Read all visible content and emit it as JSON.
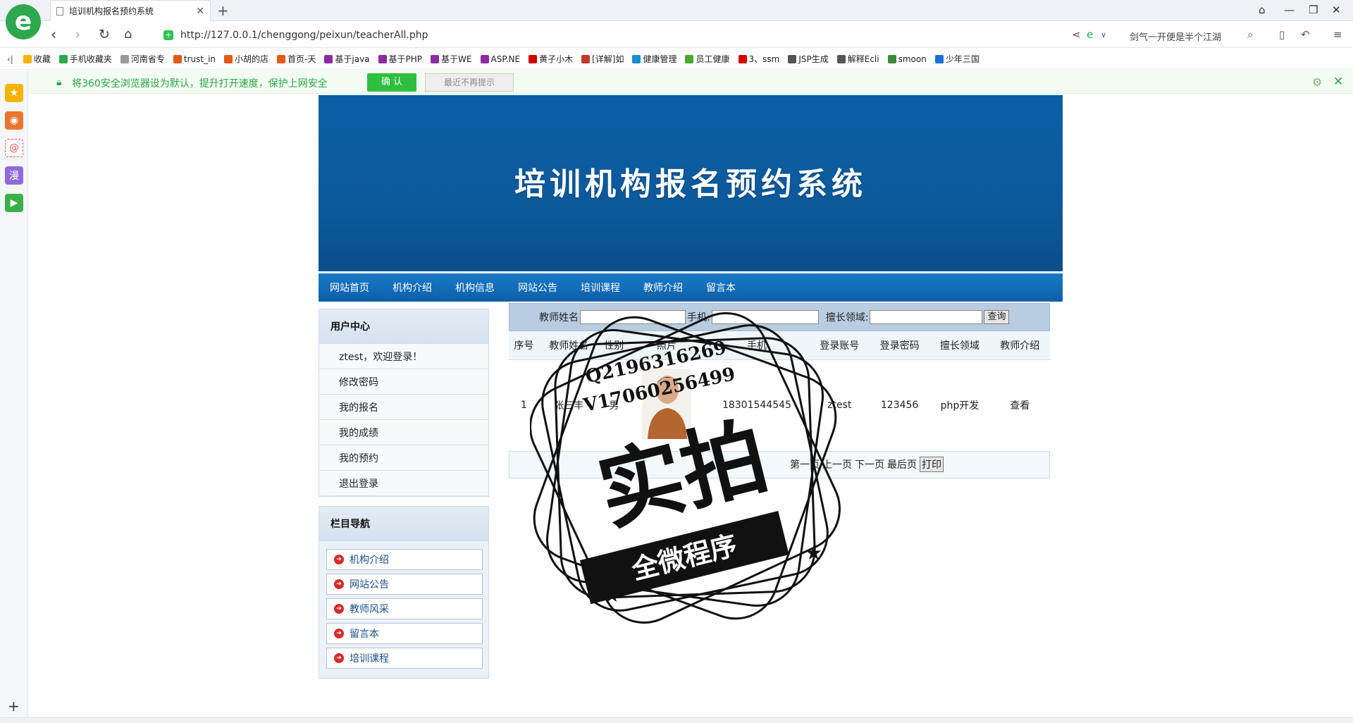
{
  "browser": {
    "tab_title": "培训机构报名预约系统",
    "url": "http://127.0.0.1/chenggong/peixun/teacherAll.php",
    "search_text": "剑气一开便是半个江湖"
  },
  "bookmarks": [
    {
      "label": "收藏",
      "color": "#f5b400"
    },
    {
      "label": "手机收藏夹",
      "color": "#2da84f"
    },
    {
      "label": "河南省专",
      "color": "#999999"
    },
    {
      "label": "trust_in",
      "color": "#e05a1a"
    },
    {
      "label": "小胡的店",
      "color": "#e05a1a"
    },
    {
      "label": "首页-天",
      "color": "#e05a1a"
    },
    {
      "label": "基于java",
      "color": "#8a2ca0"
    },
    {
      "label": "基于PHP",
      "color": "#8a2ca0"
    },
    {
      "label": "基于WE",
      "color": "#8a2ca0"
    },
    {
      "label": "ASP.NE",
      "color": "#8a2ca0"
    },
    {
      "label": "黄子小木",
      "color": "#d00000"
    },
    {
      "label": "[详解]如",
      "color": "#c0392b"
    },
    {
      "label": "健康管理",
      "color": "#1a8fd0"
    },
    {
      "label": "员工健康",
      "color": "#4aa832"
    },
    {
      "label": "3、ssm",
      "color": "#d00000"
    },
    {
      "label": "JSP生成",
      "color": "#555555"
    },
    {
      "label": "解释Ecli",
      "color": "#555555"
    },
    {
      "label": "smoon",
      "color": "#3b8b3b"
    },
    {
      "label": "少年三国",
      "color": "#1a6fd0"
    }
  ],
  "infobar": {
    "message": "将360安全浏览器设为默认，提升打开速度，保护上网安全",
    "confirm": "确 认",
    "dismiss": "最近不再提示"
  },
  "site": {
    "title": "培训机构报名预约系统",
    "nav": [
      "网站首页",
      "机构介绍",
      "机构信息",
      "网站公告",
      "培训课程",
      "教师介绍",
      "留言本"
    ]
  },
  "user_center": {
    "title": "用户中心",
    "items": [
      "ztest，欢迎登录！",
      "修改密码",
      "我的报名",
      "我的成绩",
      "我的预约",
      "退出登录"
    ]
  },
  "column_nav": {
    "title": "栏目导航",
    "items": [
      "机构介绍",
      "网站公告",
      "教师风采",
      "留言本",
      "培训课程"
    ]
  },
  "search": {
    "name_label": "教师姓名",
    "phone_label": "手机:",
    "field_label": "擅长领域:",
    "button": "查询"
  },
  "table": {
    "headers": [
      "序号",
      "教师姓名",
      "性别",
      "照片",
      "手机",
      "登录账号",
      "登录密码",
      "擅长领域",
      "教师介绍"
    ],
    "rows": [
      {
        "no": "1",
        "name": "张三丰",
        "gender": "男",
        "phone": "18301544545",
        "account": "ztest",
        "password": "123456",
        "field": "php开发",
        "intro": "查看"
      }
    ]
  },
  "pager": {
    "first": "第一页",
    "prev": "上一页",
    "next": "下一页",
    "last": "最后页",
    "print": "打印"
  },
  "watermark": {
    "qq": "Q2196316269",
    "v": "V17060256499",
    "big": "实拍",
    "banner": "全微程序"
  }
}
